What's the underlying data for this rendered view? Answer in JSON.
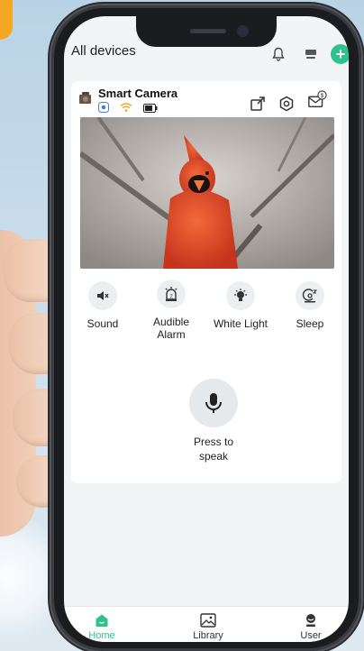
{
  "header": {
    "title": "All devices",
    "icons": [
      "bell-icon",
      "gateway-icon",
      "add-icon"
    ],
    "add_symbol": "+"
  },
  "device": {
    "name": "Smart Camera",
    "status_icons": [
      "recording-icon",
      "wifi-icon",
      "battery-icon"
    ],
    "action_icons": [
      "share-icon",
      "settings-icon",
      "messages-icon"
    ],
    "message_badge": "$"
  },
  "controls": [
    {
      "label": "Sound",
      "icon": "speaker-muted-icon"
    },
    {
      "label": "Audible\nAlarm",
      "icon": "alarm-icon"
    },
    {
      "label": "White Light",
      "icon": "light-bulb-icon"
    },
    {
      "label": "Sleep",
      "icon": "sleep-icon"
    }
  ],
  "talk": {
    "label": "Press to\nspeak",
    "icon": "microphone-icon"
  },
  "tabs": [
    {
      "label": "Home",
      "active": true,
      "icon": "home-icon"
    },
    {
      "label": "Library",
      "active": false,
      "icon": "gallery-icon"
    },
    {
      "label": "User",
      "active": false,
      "icon": "user-icon"
    }
  ],
  "colors": {
    "accent": "#2fc28b",
    "feed_subject": "#e5452a"
  }
}
